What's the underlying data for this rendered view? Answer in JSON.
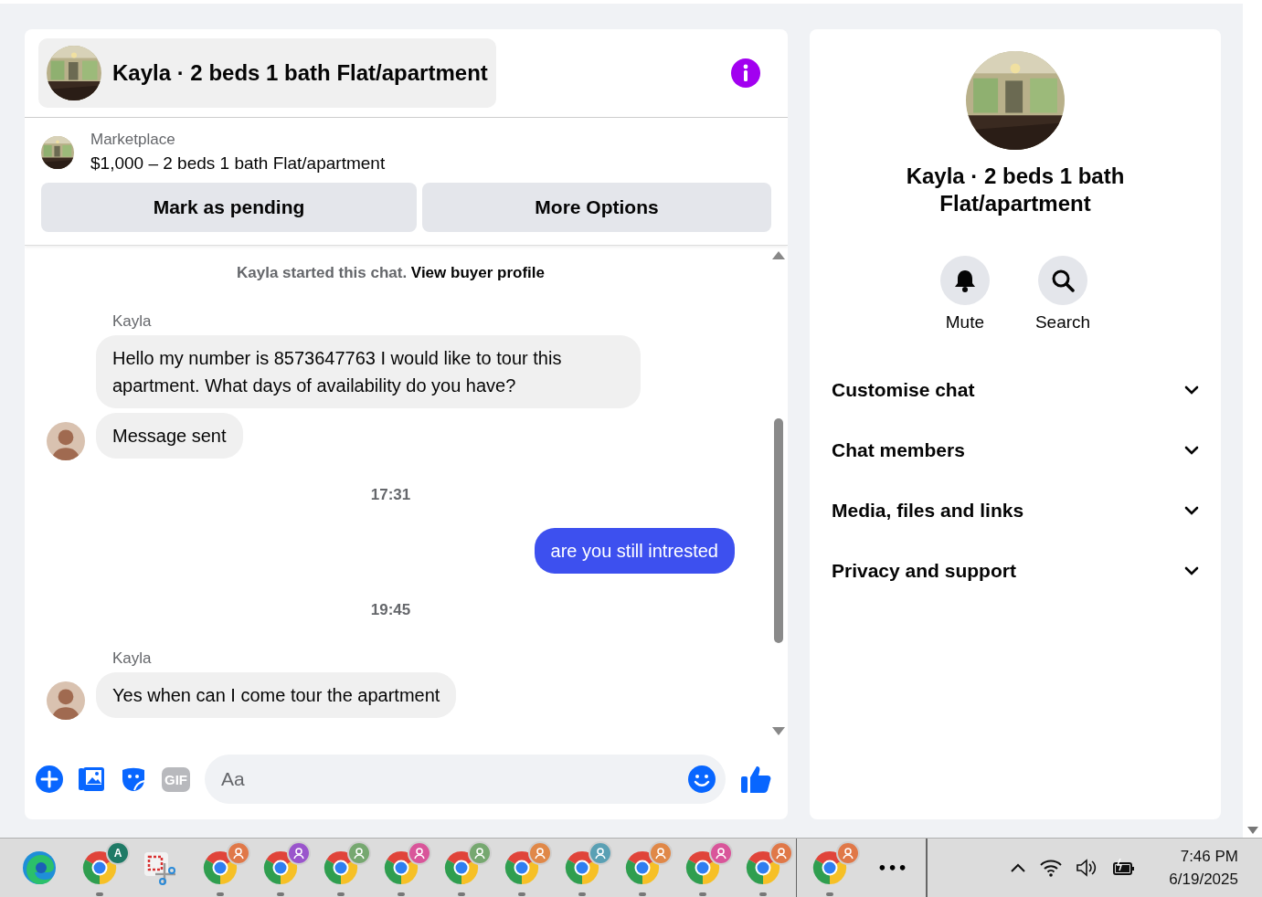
{
  "conversation": {
    "title": "Kayla · 2 beds 1 bath Flat/apartment"
  },
  "listing": {
    "source": "Marketplace",
    "summary": "$1,000 – 2 beds 1 bath Flat/apartment",
    "buttons": [
      "Mark as pending",
      "More Options"
    ]
  },
  "thread": [
    {
      "kind": "notice",
      "text": "Kayla started this chat.",
      "link": "View buyer profile"
    },
    {
      "kind": "sender",
      "text": "Kayla"
    },
    {
      "kind": "incoming",
      "text": "Hello my number is 8573647763 I would like to tour this apartment. What days of availability do you have?",
      "avatar": false
    },
    {
      "kind": "incoming",
      "text": "Message sent",
      "avatar": true
    },
    {
      "kind": "time",
      "text": "17:31"
    },
    {
      "kind": "outgoing",
      "text": "are you still intrested"
    },
    {
      "kind": "time",
      "text": "19:45"
    },
    {
      "kind": "sender",
      "text": "Kayla"
    },
    {
      "kind": "incoming",
      "text": "Yes when can I come tour the apartment",
      "avatar": true
    }
  ],
  "composer": {
    "gif_label": "GIF",
    "placeholder": "Aa"
  },
  "profile": {
    "name": "Kayla · 2 beds 1 bath Flat/apartment",
    "actions": [
      {
        "kind": "mute",
        "label": "Mute"
      },
      {
        "kind": "search",
        "label": "Search"
      }
    ],
    "sections": [
      {
        "label": "Customise chat",
        "expanded": false
      },
      {
        "label": "Chat members",
        "expanded": false
      },
      {
        "label": "Media, files and links",
        "expanded": false
      },
      {
        "label": "Privacy and support",
        "expanded": false
      }
    ]
  },
  "taskbar": {
    "apps": [
      {
        "kind": "edge",
        "running": false
      },
      {
        "kind": "chrome",
        "badge": "A",
        "color": "#1f7a66",
        "running": true
      },
      {
        "kind": "snip",
        "running": false
      },
      {
        "kind": "chrome",
        "color": "#e07848",
        "running": true
      },
      {
        "kind": "chrome",
        "color": "#9a55cc",
        "running": true
      },
      {
        "kind": "chrome",
        "color": "#76a870",
        "running": true
      },
      {
        "kind": "chrome",
        "color": "#d9559a",
        "running": true
      },
      {
        "kind": "chrome",
        "color": "#76a870",
        "running": true
      },
      {
        "kind": "chrome",
        "color": "#e08848",
        "running": true
      },
      {
        "kind": "chrome",
        "color": "#5aa0b4",
        "running": true
      },
      {
        "kind": "chrome",
        "color": "#e08848",
        "running": true
      },
      {
        "kind": "chrome",
        "color": "#d9559a",
        "running": true
      },
      {
        "kind": "chrome",
        "color": "#e07848",
        "running": true
      },
      {
        "kind": "separator"
      },
      {
        "kind": "chrome",
        "color": "#e07848",
        "running": true
      },
      {
        "kind": "more",
        "label": "•••"
      }
    ],
    "time": "7:46 PM",
    "date": "6/19/2025"
  }
}
